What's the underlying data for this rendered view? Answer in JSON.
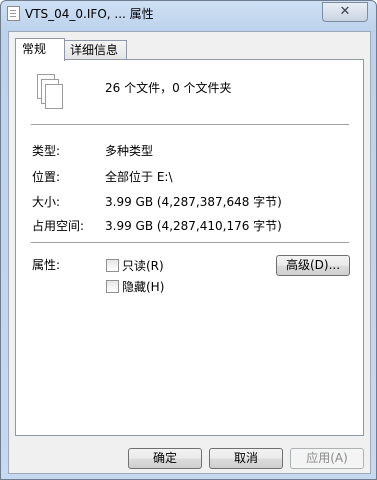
{
  "window": {
    "title": "VTS_04_0.IFO, ... 属性",
    "close_symbol": "✕"
  },
  "tabs": [
    {
      "label": "常规",
      "active": true
    },
    {
      "label": "详细信息",
      "active": false
    }
  ],
  "summary": {
    "icon": "multiple-files-icon",
    "text": "26 个文件，0 个文件夹"
  },
  "properties": {
    "type_label": "类型:",
    "type_value": "多种类型",
    "location_label": "位置:",
    "location_value": "全部位于 E:\\",
    "size_label": "大小:",
    "size_value": "3.99 GB (4,287,387,648 字节)",
    "disk_label": "占用空间:",
    "disk_value": "3.99 GB (4,287,410,176 字节)"
  },
  "attributes": {
    "label": "属性:",
    "readonly": {
      "label": "只读(R)",
      "checked": false
    },
    "hidden": {
      "label": "隐藏(H)",
      "checked": false
    },
    "advanced_label": "高级(D)..."
  },
  "buttons": {
    "ok": "确定",
    "cancel": "取消",
    "apply": "应用(A)"
  }
}
